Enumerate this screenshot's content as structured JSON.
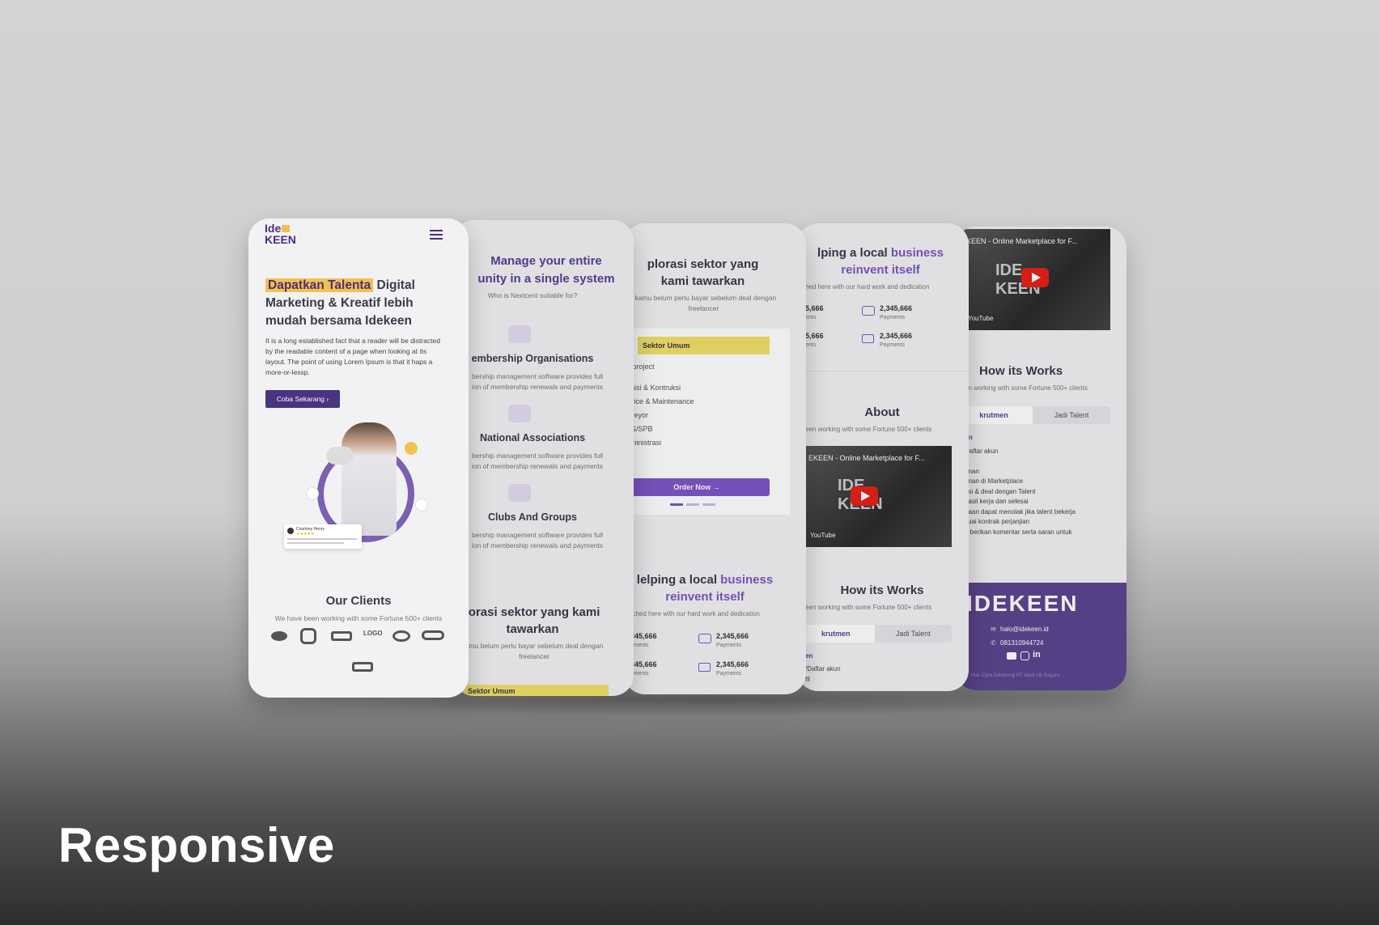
{
  "caption": "Responsive",
  "colors": {
    "brand_purple": "#5b3e96",
    "accent_yellow": "#f1c24f",
    "cta_purple": "#7d57c9"
  },
  "screen1": {
    "logo_line1": "Ide",
    "logo_line2": "KEEN",
    "hero_highlight": "Dapatkan Talenta",
    "hero_title_rest": " Digital Marketing & Kreatif lebih mudah bersama Idekeen",
    "hero_body": "It is a long established fact that a reader will be distracted by the readable content of a page when looking at its layout. The point of using Lorem Ipsum is that it haps a more-or-lessp.",
    "cta": "Coba Sekarang",
    "review_name": "Courtney Henry",
    "clients_title": "Our Clients",
    "clients_sub": "We have been working with some Fortune 500+ clients"
  },
  "screen2": {
    "title_a": "Manage your entire",
    "title_b": "unity in a single system",
    "subtitle": "Who is Nextcent suitable for?",
    "items": [
      {
        "title": "embership Organisations",
        "desc1": "bership management software provides full",
        "desc2": "ion of membership renewals and payments"
      },
      {
        "title": "National Associations",
        "desc1": "bership management software provides full",
        "desc2": "ion of membership renewals and payments"
      },
      {
        "title": "Clubs And Groups",
        "desc1": "bership management software provides full",
        "desc2": "ion of membership renewals and payments"
      }
    ],
    "bottom_title": "lorasi sektor yang kami tawarkan",
    "bottom_sub1": "amu belum perlu bayar sebelum deal dengan",
    "bottom_sub2": "freelancer",
    "bottom_tag": "Sektor Umum"
  },
  "screen3": {
    "title": "plorasi sektor yang kami tawarkan",
    "sub1": ", kamu belum perlu bayar sebelum deal dengan",
    "sub2": "freelancer",
    "tag": "Sektor Umum",
    "price": "/project",
    "list": [
      "nisi & Kontruksi",
      "vice & Maintenance",
      "veyor",
      "G/SPB",
      "ministrasi"
    ],
    "order": "Order Now",
    "help_a": "lelping a local ",
    "help_b": "business",
    "help_c": "reinvent itself",
    "help_sub": "ached here with our hard work and dedication",
    "stats": [
      {
        "left": "345,666",
        "left_label": "yments",
        "right": "2,345,666",
        "right_label": "Payments"
      },
      {
        "left": "345,666",
        "left_label": "yments",
        "right": "2,345,666",
        "right_label": "Payments"
      }
    ]
  },
  "screen4": {
    "help_a": "lping a local ",
    "help_b": "business",
    "help_c": "reinvent itself",
    "help_sub": "hed here with our hard work and dedication",
    "stats": [
      {
        "left": "5,666",
        "left_label": "ents",
        "right": "2,345,666",
        "right_label": "Payments"
      },
      {
        "left": "5,666",
        "left_label": "ents",
        "right": "2,345,666",
        "right_label": "Payments"
      }
    ],
    "about_title": "About",
    "about_sub": "een working with some Fortune 500+ clients",
    "video_title": "EKEEN - Online Marketplace for F...",
    "yt_label": "YouTube",
    "works_title": "How its Works",
    "works_sub": "een working with some Fortune 500+ clients",
    "tab_a": "krutmen",
    "tab_b": "Jadi Talent",
    "step_head": "en",
    "step1": "/Daftar akun",
    "step2": "fil"
  },
  "screen5": {
    "video_title": "KEEN - Online Marketplace for F...",
    "yt_label": "YouTube",
    "works_title": "How its Works",
    "works_sub": "en working with some Fortune 500+ clients",
    "tab_a": "krutmen",
    "tab_b": "Jadi Talent",
    "step_head": "un",
    "steps": [
      "Daftar akun",
      "anan",
      "anan di Marketplace",
      "asi & deal dengan Talent",
      "hasil kerja dan selesai",
      "naan dapat menolak jika talent bekerja",
      "suai kontrak perjanjian",
      "n berikan komentar serta saran untuk"
    ],
    "footer_logo": "IDEKEEN",
    "email": "halo@idekeen.id",
    "phone": "081310944724",
    "copyright": "Hak Cipta Dilindungi PT Ideal Idé Bagara"
  }
}
